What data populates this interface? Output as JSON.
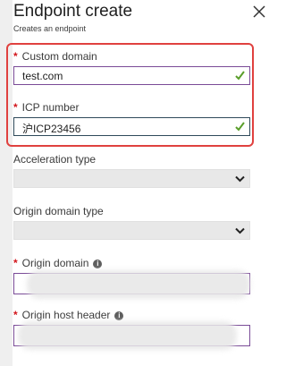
{
  "header": {
    "title": "Endpoint create",
    "subtitle": "Creates an endpoint"
  },
  "fields": {
    "custom_domain": {
      "label": "Custom domain",
      "value": "test.com",
      "required": true,
      "valid": true
    },
    "icp_number": {
      "label": "ICP number",
      "value": "沪ICP23456",
      "required": true,
      "valid": true
    },
    "acceleration_type": {
      "label": "Acceleration type",
      "value": ""
    },
    "origin_domain_type": {
      "label": "Origin domain type",
      "value": ""
    },
    "origin_domain": {
      "label": "Origin domain",
      "value": "",
      "required": true
    },
    "origin_host_header": {
      "label": "Origin host header",
      "value": "",
      "required": true
    }
  },
  "glyphs": {
    "required_marker": "*",
    "info_icon": "i"
  },
  "colors": {
    "required": "#d2161c",
    "valid_check": "#5a9e2a",
    "highlight_box": "#e0413f",
    "input_border": "#7a4b97"
  }
}
